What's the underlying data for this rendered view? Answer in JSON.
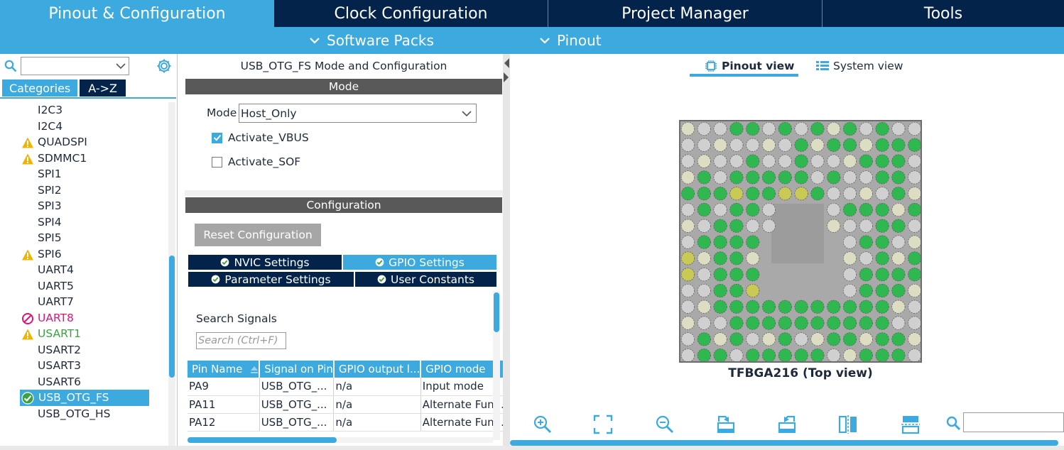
{
  "top_tabs": [
    "Pinout & Configuration",
    "Clock Configuration",
    "Project Manager",
    "Tools"
  ],
  "sub_menu": {
    "software_packs": "Software Packs",
    "pinout": "Pinout"
  },
  "left": {
    "search_value": "",
    "tabs": [
      "Categories",
      "A->Z"
    ],
    "items": [
      {
        "label": "I2C3",
        "status": "none"
      },
      {
        "label": "I2C4",
        "status": "none"
      },
      {
        "label": "QUADSPI",
        "status": "warning"
      },
      {
        "label": "SDMMC1",
        "status": "warning"
      },
      {
        "label": "SPI1",
        "status": "none"
      },
      {
        "label": "SPI2",
        "status": "none"
      },
      {
        "label": "SPI3",
        "status": "none"
      },
      {
        "label": "SPI4",
        "status": "none"
      },
      {
        "label": "SPI5",
        "status": "none"
      },
      {
        "label": "SPI6",
        "status": "warning"
      },
      {
        "label": "UART4",
        "status": "none"
      },
      {
        "label": "UART5",
        "status": "none"
      },
      {
        "label": "UART7",
        "status": "none"
      },
      {
        "label": "UART8",
        "status": "error"
      },
      {
        "label": "USART1",
        "status": "warning-green"
      },
      {
        "label": "USART2",
        "status": "none"
      },
      {
        "label": "USART3",
        "status": "none"
      },
      {
        "label": "USART6",
        "status": "none"
      },
      {
        "label": "USB_OTG_FS",
        "status": "ok-selected"
      },
      {
        "label": "USB_OTG_HS",
        "status": "none"
      }
    ]
  },
  "middle": {
    "title": "USB_OTG_FS Mode and Configuration",
    "mode_header": "Mode",
    "mode_label": "Mode",
    "mode_value": "Host_Only",
    "activate_vbus": "Activate_VBUS",
    "activate_sof": "Activate_SOF",
    "config_header": "Configuration",
    "reset_button": "Reset Configuration",
    "tabs": {
      "nvic": "NVIC Settings",
      "gpio": "GPIO Settings",
      "parameter": "Parameter Settings",
      "user_constants": "User Constants"
    },
    "search_signals_label": "Search Signals",
    "search_placeholder": "Search (Ctrl+F)",
    "table": {
      "headers": [
        "Pin Name",
        "Signal on Pin",
        "GPIO output l...",
        "GPIO mode"
      ],
      "rows": [
        [
          "PA9",
          "USB_OTG_...",
          "n/a",
          "Input mode"
        ],
        [
          "PA11",
          "USB_OTG_...",
          "n/a",
          "Alternate Fun..."
        ],
        [
          "PA12",
          "USB_OTG_...",
          "n/a",
          "Alternate Fun..."
        ]
      ]
    }
  },
  "right": {
    "pinout_view": "Pinout view",
    "system_view": "System view",
    "chip_label": "TFBGA216 (Top view)",
    "colors": {
      "green": "#2fb84f",
      "yellow": "#c9c955",
      "pale": "#ddddc4",
      "gray": "#d0d0d0"
    }
  },
  "colors": {
    "accent": "#3ca9df",
    "navy": "#03234b",
    "warning": "#f0b400",
    "error": "#e0137a",
    "ok": "#3aa241"
  }
}
